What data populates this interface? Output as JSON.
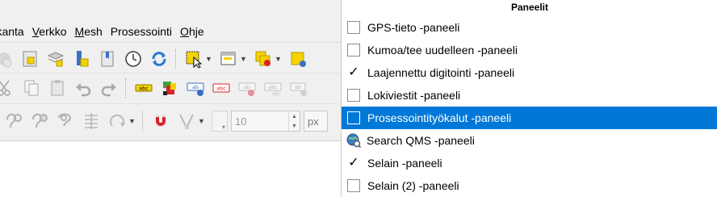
{
  "menubar": {
    "items": [
      {
        "pre": "",
        "u": "",
        "post": "etokanta"
      },
      {
        "pre": "",
        "u": "V",
        "post": "erkko"
      },
      {
        "pre": "",
        "u": "M",
        "post": "esh"
      },
      {
        "pre": "Prosessointi",
        "u": "",
        "post": ""
      },
      {
        "pre": "",
        "u": "O",
        "post": "hje"
      }
    ]
  },
  "toolbar3": {
    "tolerance_value": "10",
    "unit_label": "px"
  },
  "panels_menu": {
    "title": "Paneelit",
    "items": [
      {
        "label": "GPS-tieto -paneeli",
        "checked": false
      },
      {
        "label": "Kumoa/tee uudelleen -paneeli",
        "checked": false
      },
      {
        "label": "Laajennettu digitointi -paneeli",
        "checked": true
      },
      {
        "label": "Lokiviestit -paneeli",
        "checked": false
      },
      {
        "label": "Prosessointityökalut -paneeli",
        "checked": false,
        "selected": true
      },
      {
        "label": "Search QMS -paneeli",
        "icon": "search-qms-icon"
      },
      {
        "label": "Selain -paneeli",
        "checked": true
      },
      {
        "label": "Selain (2) -paneeli",
        "checked": false
      }
    ],
    "check_mark": "✓"
  },
  "colors": {
    "selection": "#0078d7",
    "refresh_blue": "#2a7bd0",
    "yellow": "#f5d200",
    "red": "#d9232a"
  }
}
